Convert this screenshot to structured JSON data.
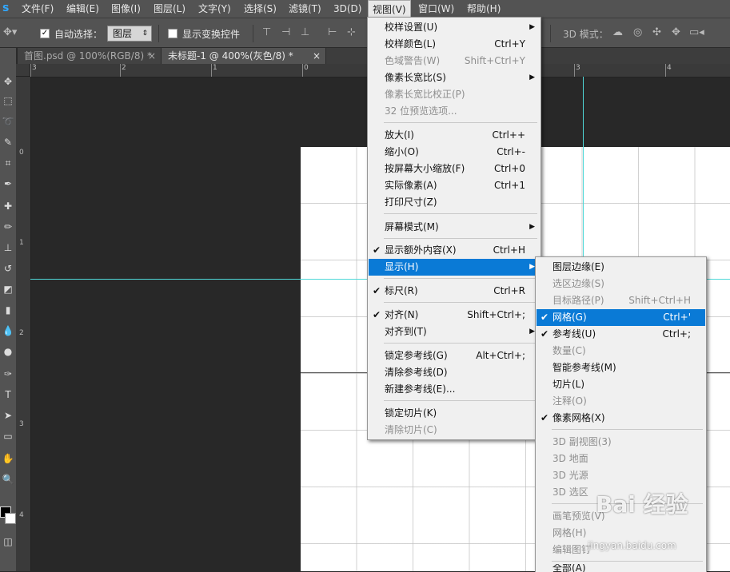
{
  "menubar": {
    "logo": "s",
    "items": [
      "文件(F)",
      "编辑(E)",
      "图像(I)",
      "图层(L)",
      "文字(Y)",
      "选择(S)",
      "滤镜(T)",
      "3D(D)",
      "视图(V)",
      "窗口(W)",
      "帮助(H)"
    ]
  },
  "options": {
    "auto_select_label": "自动选择：",
    "auto_select_checked": true,
    "layer_select": "图层",
    "show_transform_label": "显示变换控件",
    "mode_3d_label": "3D 模式："
  },
  "tabs": [
    "首图.psd @ 100%(RGB/8) *",
    "未标题-1 @ 400%(灰色/8) *"
  ],
  "rulers": {
    "h_labels": [
      "3",
      "2",
      "1",
      "0",
      "1",
      "2",
      "3",
      "4"
    ],
    "v_labels": [
      "0",
      "1",
      "2",
      "3",
      "4"
    ]
  },
  "view_menu": {
    "items": [
      {
        "label": "校样设置(U)",
        "arrow": true
      },
      {
        "label": "校样颜色(L)",
        "shortcut": "Ctrl+Y"
      },
      {
        "label": "色域警告(W)",
        "shortcut": "Shift+Ctrl+Y",
        "disabled": true
      },
      {
        "label": "像素长宽比(S)",
        "arrow": true
      },
      {
        "label": "像素长宽比校正(P)",
        "disabled": true
      },
      {
        "label": "32 位预览选项...",
        "disabled": true
      },
      {
        "label": "放大(I)",
        "shortcut": "Ctrl++"
      },
      {
        "label": "缩小(O)",
        "shortcut": "Ctrl+-"
      },
      {
        "label": "按屏幕大小缩放(F)",
        "shortcut": "Ctrl+0"
      },
      {
        "label": "实际像素(A)",
        "shortcut": "Ctrl+1"
      },
      {
        "label": "打印尺寸(Z)"
      },
      {
        "label": "屏幕模式(M)",
        "arrow": true
      },
      {
        "label": "显示额外内容(X)",
        "shortcut": "Ctrl+H",
        "checked": true
      },
      {
        "label": "显示(H)",
        "arrow": true,
        "highlighted": true
      },
      {
        "label": "标尺(R)",
        "shortcut": "Ctrl+R",
        "checked": true
      },
      {
        "label": "对齐(N)",
        "shortcut": "Shift+Ctrl+;",
        "checked": true
      },
      {
        "label": "对齐到(T)",
        "arrow": true
      },
      {
        "label": "锁定参考线(G)",
        "shortcut": "Alt+Ctrl+;"
      },
      {
        "label": "清除参考线(D)"
      },
      {
        "label": "新建参考线(E)..."
      },
      {
        "label": "锁定切片(K)"
      },
      {
        "label": "清除切片(C)",
        "disabled": true
      }
    ]
  },
  "show_submenu": {
    "items": [
      {
        "label": "图层边缘(E)"
      },
      {
        "label": "选区边缘(S)",
        "disabled": true
      },
      {
        "label": "目标路径(P)",
        "shortcut": "Shift+Ctrl+H",
        "disabled": true
      },
      {
        "label": "网格(G)",
        "shortcut": "Ctrl+'",
        "checked": true,
        "highlighted": true
      },
      {
        "label": "参考线(U)",
        "shortcut": "Ctrl+;",
        "checked": true
      },
      {
        "label": "数量(C)",
        "disabled": true
      },
      {
        "label": "智能参考线(M)"
      },
      {
        "label": "切片(L)"
      },
      {
        "label": "注释(O)",
        "disabled": true
      },
      {
        "label": "像素网格(X)",
        "checked": true
      },
      {
        "label": "3D 副视图(3)",
        "disabled": true
      },
      {
        "label": "3D 地面",
        "disabled": true
      },
      {
        "label": "3D 光源",
        "disabled": true
      },
      {
        "label": "3D 选区",
        "disabled": true
      },
      {
        "label": "画笔预览(V)",
        "disabled": true
      },
      {
        "label": "网格(H)",
        "disabled": true
      },
      {
        "label": "编辑图钉",
        "disabled": true
      },
      {
        "label": "全部(A)"
      }
    ]
  },
  "watermark": {
    "text": "Bai 经验",
    "url": "jingyan.baidu.com"
  },
  "colors": {
    "highlight": "#0a7ad6",
    "guide": "#4fd8d8",
    "chrome": "#535353",
    "workspace": "#282828"
  }
}
